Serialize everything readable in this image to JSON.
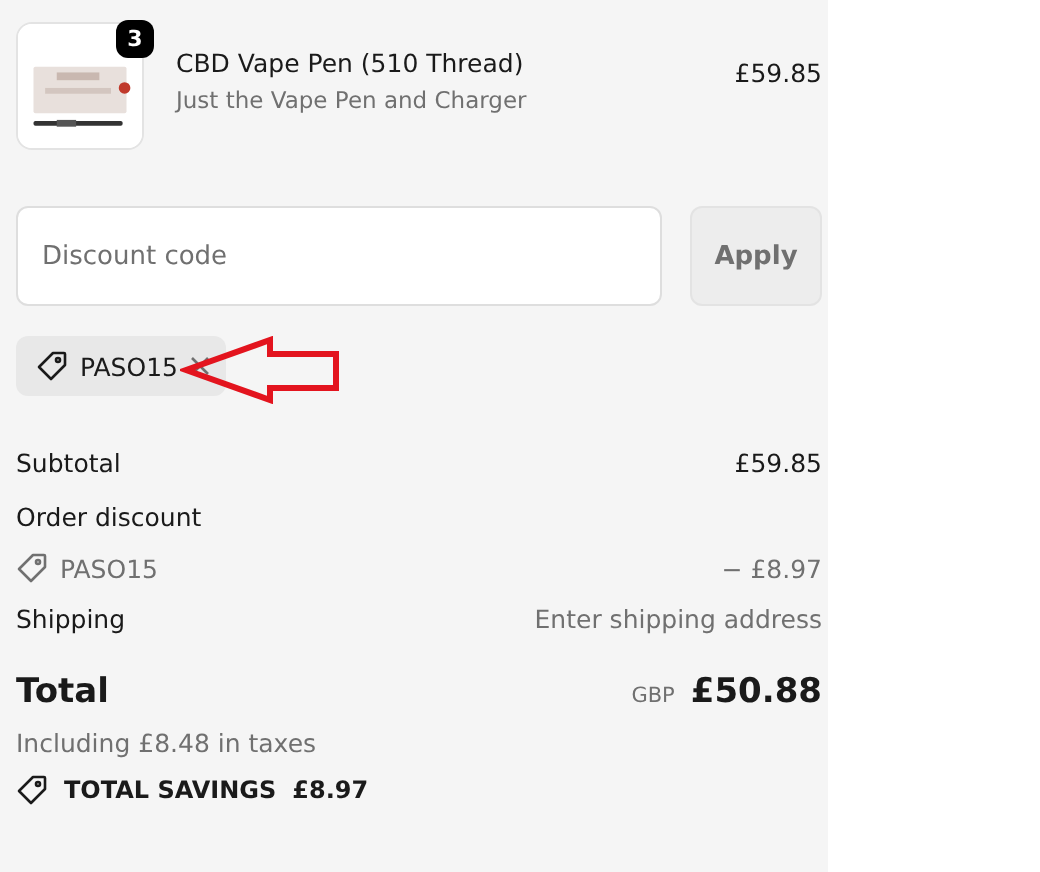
{
  "line_items": [
    {
      "quantity": "3",
      "title": "CBD Vape Pen (510 Thread)",
      "variant": "Just the Vape Pen and Charger",
      "price": "£59.85"
    }
  ],
  "discount": {
    "placeholder": "Discount code",
    "apply_button": "Apply"
  },
  "applied_codes": [
    {
      "code": "PASO15"
    }
  ],
  "summary": {
    "rows": [
      {
        "kind": "line",
        "label": "Subtotal",
        "value": "£59.85"
      },
      {
        "kind": "heading",
        "label": "Order discount"
      },
      {
        "kind": "code",
        "label": "PASO15",
        "value": "− £8.97"
      },
      {
        "kind": "note",
        "label": "Shipping",
        "value": "Enter shipping address"
      }
    ],
    "total": {
      "label": "Total",
      "currency": "GBP",
      "amount": "£50.88"
    },
    "taxes": "Including £8.48 in taxes",
    "savings": {
      "label": "TOTAL SAVINGS",
      "amount": "£8.97"
    }
  }
}
